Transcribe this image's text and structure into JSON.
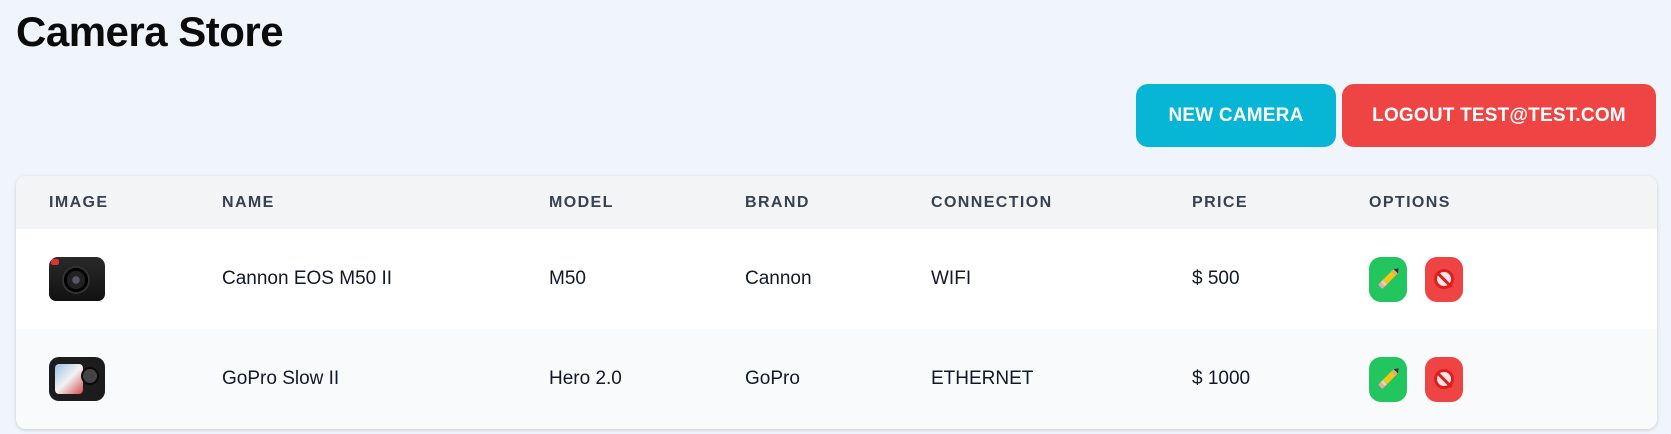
{
  "header": {
    "title": "Camera Store"
  },
  "toolbar": {
    "new_label": "NEW CAMERA",
    "logout_label": "LOGOUT TEST@TEST.COM"
  },
  "colors": {
    "accent_cyan": "#06b6d4",
    "danger_red": "#ef4444",
    "success_green": "#22c55e",
    "page_bg": "#f0f4fb"
  },
  "table": {
    "columns": [
      "IMAGE",
      "NAME",
      "MODEL",
      "BRAND",
      "CONNECTION",
      "PRICE",
      "OPTIONS"
    ],
    "rows": [
      {
        "image_icon": "dslr-camera-thumbnail",
        "name": "Cannon EOS M50 II",
        "model": "M50",
        "brand": "Cannon",
        "connection": "WIFI",
        "price": "$ 500",
        "options": [
          "pencil-icon",
          "ban-icon"
        ]
      },
      {
        "image_icon": "action-camera-thumbnail",
        "name": "GoPro Slow II",
        "model": "Hero 2.0",
        "brand": "GoPro",
        "connection": "ETHERNET",
        "price": "$ 1000",
        "options": [
          "pencil-icon",
          "ban-icon"
        ]
      }
    ]
  }
}
